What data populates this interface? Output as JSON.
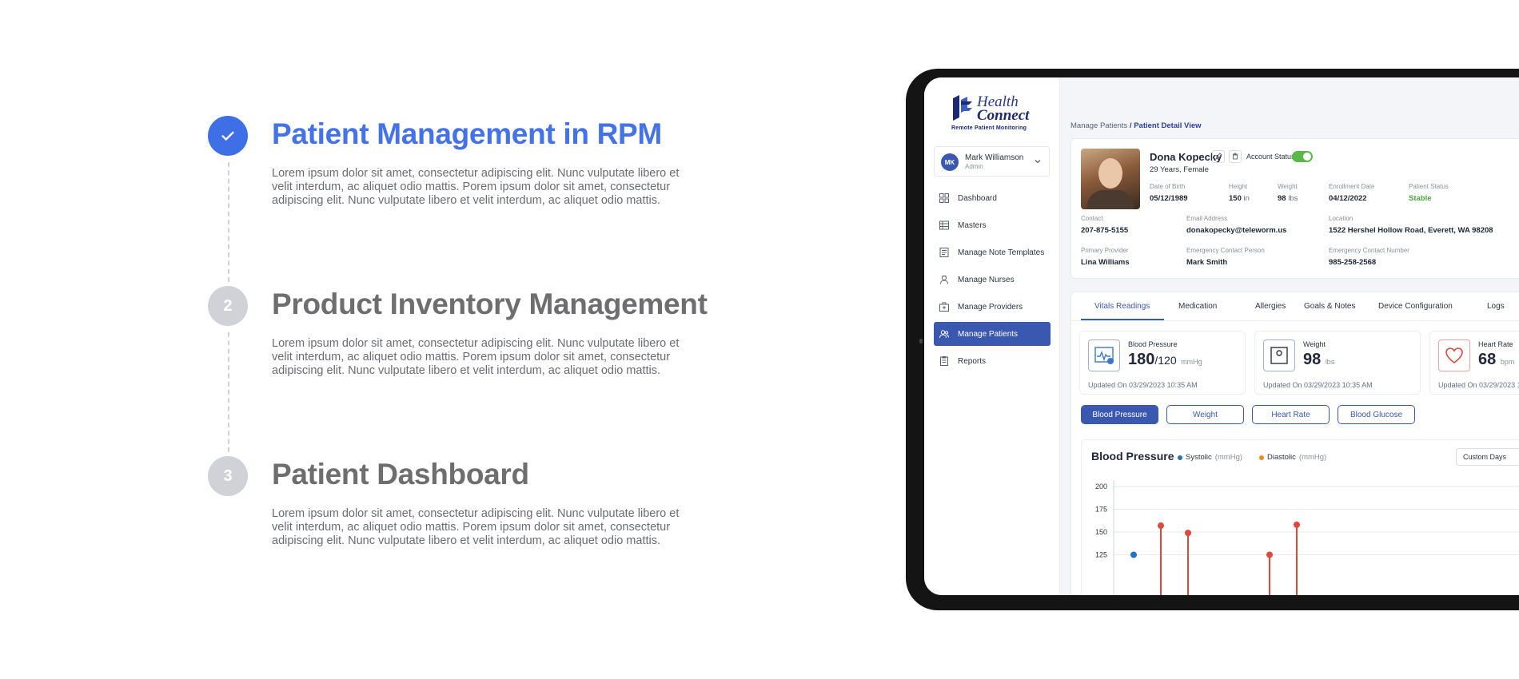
{
  "steps": [
    {
      "number": "",
      "title": "Patient Management in RPM",
      "description": "Lorem ipsum dolor sit amet, consectetur adipiscing elit. Nunc vulputate libero et velit interdum, ac aliquet odio mattis. Porem ipsum dolor sit amet, consectetur adipiscing elit. Nunc vulputate libero et velit interdum, ac aliquet odio mattis."
    },
    {
      "number": "2",
      "title": "Product Inventory Management",
      "description": "Lorem ipsum dolor sit amet, consectetur adipiscing elit. Nunc vulputate libero et velit interdum, ac aliquet odio mattis. Porem ipsum dolor sit amet, consectetur adipiscing elit. Nunc vulputate libero et velit interdum, ac aliquet odio mattis."
    },
    {
      "number": "3",
      "title": "Patient Dashboard",
      "description": "Lorem ipsum dolor sit amet, consectetur adipiscing elit. Nunc vulputate libero et velit interdum, ac aliquet odio mattis. Porem ipsum dolor sit amet, consectetur adipiscing elit. Nunc vulputate libero et velit interdum, ac aliquet odio mattis."
    }
  ],
  "app": {
    "logo_line1": "Health",
    "logo_line2": "Connect",
    "logo_sub": "Remote Patient Monitoring",
    "user": {
      "initials": "MK",
      "name": "Mark Williamson",
      "role": "Admin"
    },
    "nav": [
      {
        "label": "Dashboard",
        "icon": "grid-icon"
      },
      {
        "label": "Masters",
        "icon": "table-icon"
      },
      {
        "label": "Manage Note Templates",
        "icon": "note-icon"
      },
      {
        "label": "Manage Nurses",
        "icon": "nurse-icon"
      },
      {
        "label": "Manage Providers",
        "icon": "provider-icon"
      },
      {
        "label": "Manage Patients",
        "icon": "patients-icon",
        "active": true
      },
      {
        "label": "Reports",
        "icon": "report-icon"
      }
    ],
    "breadcrumb": {
      "parent": "Manage Patients",
      "separator": " / ",
      "current": "Patient Detail View"
    },
    "patient": {
      "name": "Dona Kopecky",
      "age_gender": "29 Years, Female",
      "account_status_label": "Account Status:",
      "account_active": true,
      "fields": {
        "dob_label": "Date of Birth",
        "dob": "05/12/1989",
        "height_label": "Height",
        "height": "150",
        "height_unit": "in",
        "weight_label": "Weight",
        "weight": "98",
        "weight_unit": "lbs",
        "enroll_label": "Enrollment Date",
        "enroll": "04/12/2022",
        "status_label": "Patient Status",
        "status": "Stable",
        "contact_label": "Contact",
        "contact": "207-875-5155",
        "email_label": "Email Address",
        "email": "donakopecky@teleworm.us",
        "location_label": "Location",
        "location": "1522 Hershel Hollow Road, Everett, WA 98208",
        "provider_label": "Primary Provider",
        "provider": "Lina Williams",
        "ec_person_label": "Emergency Contact Person",
        "ec_person": "Mark Smith",
        "ec_number_label": "Emergency Contact Number",
        "ec_number": "985-258-2568"
      }
    },
    "tabs": [
      "Vitals Readings",
      "Medication",
      "Allergies",
      "Goals & Notes",
      "Device Configuration",
      "Logs"
    ],
    "vitals": [
      {
        "name": "Blood Pressure",
        "value": "180",
        "value2": "120",
        "unit": "mmHg",
        "updated": "Updated On 03/29/2023 10:35 AM"
      },
      {
        "name": "Weight",
        "value": "98",
        "unit": "lbs",
        "updated": "Updated On 03/29/2023 10:35 AM"
      },
      {
        "name": "Heart Rate",
        "value": "68",
        "unit": "bpm",
        "updated": "Updated On 03/29/2023 10:35 AM"
      }
    ],
    "filters": [
      "Blood Pressure",
      "Weight",
      "Heart Rate",
      "Blood Glucose"
    ],
    "chart": {
      "title": "Blood Pressure",
      "legend": [
        {
          "name": "Systolic",
          "unit": "(mmHg)",
          "color": "#2a6fb8"
        },
        {
          "name": "Diastolic",
          "unit": "(mmHg)",
          "color": "#f08a24"
        }
      ],
      "range_label": "Custom Days"
    }
  },
  "chart_data": {
    "type": "scatter",
    "title": "Blood Pressure",
    "ylim": [
      125,
      200
    ],
    "yticks": [
      200,
      175,
      150,
      125
    ],
    "grid": true,
    "series": [
      {
        "name": "Systolic",
        "points": [
          {
            "x": 1,
            "y": 125,
            "color": "#2a6fb8"
          }
        ]
      },
      {
        "name": "Readings",
        "points": [
          {
            "x": 2,
            "y": 157,
            "color": "#e0483a"
          },
          {
            "x": 3,
            "y": 149,
            "color": "#e0483a"
          },
          {
            "x": 6,
            "y": 125,
            "color": "#e0483a"
          },
          {
            "x": 7,
            "y": 158,
            "color": "#e0483a"
          }
        ]
      }
    ],
    "x_domain": [
      0,
      12
    ]
  }
}
